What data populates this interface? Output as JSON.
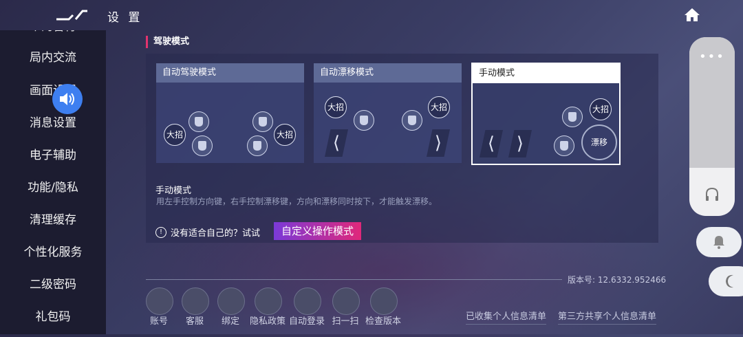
{
  "header": {
    "title": "设 置"
  },
  "sidebar": {
    "items": [
      "个的音符",
      "局内交流",
      "画面设置",
      "消息设置",
      "电子辅助",
      "功能/隐私",
      "清理缓存",
      "个性化服务",
      "二级密码",
      "礼包码"
    ]
  },
  "section": {
    "title": "驾驶模式"
  },
  "modes": [
    {
      "title": "自动驾驶模式"
    },
    {
      "title": "自动漂移模式"
    },
    {
      "title": "手动模式"
    }
  ],
  "skills": {
    "ultimate": "大招",
    "drift": "漂移"
  },
  "description": {
    "title": "手动模式",
    "text": "用左手控制方向键，右手控制漂移键，方向和漂移同时按下，才能触发漂移。"
  },
  "tip": {
    "text": "没有适合自己的？试试",
    "button": "自定义操作模式"
  },
  "version": "版本号: 12.6332.952466",
  "bottom_actions": [
    "账号",
    "客服",
    "绑定",
    "隐私政策",
    "自动登录",
    "扫一扫",
    "检查版本"
  ],
  "links": [
    "已收集个人信息清单",
    "第三方共享个人信息清单"
  ],
  "colors": {
    "accent": "#e2336e",
    "speaker": "#3e7ff0",
    "sidebar_bg": "#1c1c30"
  }
}
